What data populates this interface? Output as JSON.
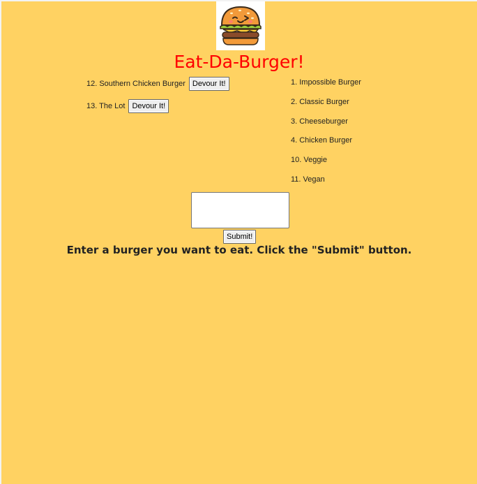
{
  "logo": {
    "icon": "burger-logo-icon",
    "alt": "cute burger mascot"
  },
  "title": "Eat-Da-Burger!",
  "uneaten_burgers": [
    {
      "label": "12. Southern Chicken Burger",
      "button_label": "Devour It!"
    },
    {
      "label": "13. The Lot",
      "button_label": "Devour It!"
    }
  ],
  "eaten_burgers": [
    {
      "label": "1. Impossible Burger"
    },
    {
      "label": "2. Classic Burger"
    },
    {
      "label": "3. Cheeseburger"
    },
    {
      "label": "4. Chicken Burger"
    },
    {
      "label": "10. Veggie"
    },
    {
      "label": "11. Vegan"
    }
  ],
  "form": {
    "input_value": "",
    "submit_label": "Submit!"
  },
  "instructions": "Enter a burger you want to eat. Click the \"Submit\" button.",
  "colors": {
    "background": "#ffd262",
    "title": "#ff0000"
  }
}
